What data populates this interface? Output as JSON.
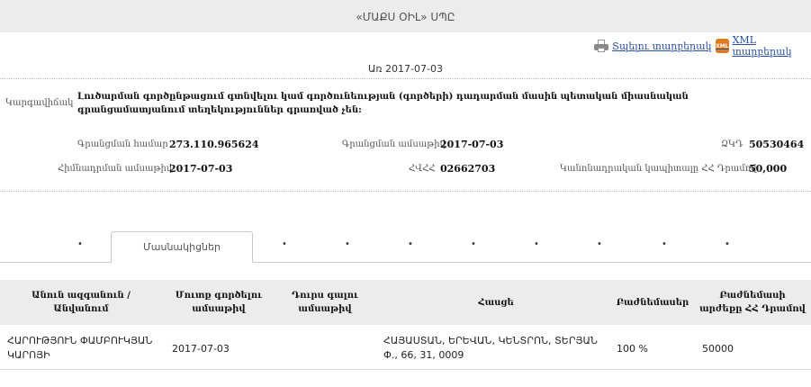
{
  "header": {
    "title": "«ՄԱՔՍ ՕԻԼ» ՍՊԸ"
  },
  "actions": {
    "print_label": "Տպելու տարբերակ",
    "xml_label": "XML տարբերակ",
    "xml_icon_text": "XML"
  },
  "as_of": "Առ 2017-07-03",
  "status": {
    "label": "Կարգավիճակ",
    "text": "Լուծարման գործընթացում գտնվելու կամ գործունեության (գործերի) դադարման մասին պետական միասնական գրանցամատյանում տեղեկություններ գրառված չեն:"
  },
  "details": {
    "reg_number_label": "Գրանցման համար",
    "reg_number": "273.110.965624",
    "reg_date_label": "Գրանցման ամսաթիվ",
    "reg_date": "2017-07-03",
    "ssn_label": "ՀՎՀՀ",
    "ssn_value": "50530464",
    "founded_label": "Հիմնադրման ամսաթիվ",
    "founded_date": "2017-07-03",
    "tax_label": "ՀՎՀՀ",
    "tax_value": "02662703",
    "capital_label": "Կանոնադրական կապիտալը ՀՀ Դրամով",
    "capital_value": "50,000",
    "ssn_short_label": "ՁԿԴ"
  },
  "tabs": {
    "active": "Մասնակիցներ",
    "dots": [
      "•",
      "•",
      "•",
      "•",
      "•",
      "•",
      "•",
      "•",
      "•",
      "•"
    ]
  },
  "table": {
    "headers": [
      "Անուն ազգանուն / Անվանում",
      "Մուտք գործելու ամսաթիվ",
      "Դուրս գալու ամսաթիվ",
      "Հասցե",
      "Բաժնեմասեր",
      "Բաժնեմասի արժեքը ՀՀ Դրամով"
    ],
    "rows": [
      [
        "ՀԱՐՈՒԹՅՈՒՆ ՓԱՄԲՈՒԿՅԱՆ ԿԱՐՈՅԻ",
        "2017-07-03",
        "",
        "ՀԱՅԱՍՏԱՆ, ԵՐԵՎԱՆ, ԿԵՆՏՐՈՆ, ՏԵՐՅԱՆ Փ., 66, 31, 0009",
        "100 %",
        "50000"
      ]
    ]
  }
}
